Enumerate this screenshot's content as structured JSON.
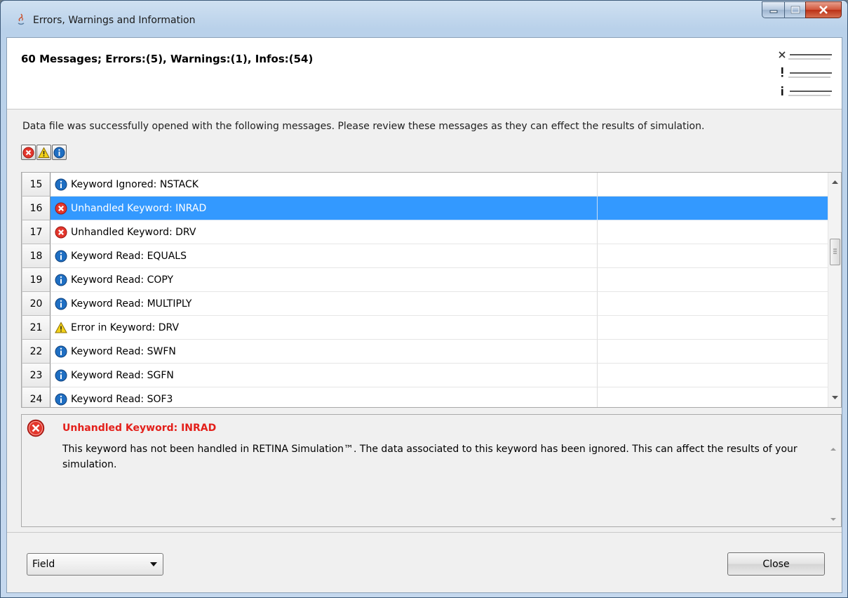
{
  "window": {
    "title": "Errors, Warnings and Information"
  },
  "header": {
    "summary": "60 Messages; Errors:(5), Warnings:(1), Infos:(54)"
  },
  "description": "Data file was successfully opened with the following messages. Please review these messages as they can effect the results of simulation.",
  "filters": [
    {
      "name": "error-filter",
      "icon": "error-icon"
    },
    {
      "name": "warning-filter",
      "icon": "warning-icon"
    },
    {
      "name": "info-filter",
      "icon": "info-icon"
    }
  ],
  "messages": [
    {
      "num": "15",
      "type": "info",
      "text": "Keyword Ignored: NSTACK"
    },
    {
      "num": "16",
      "type": "error",
      "text": "Unhandled Keyword: INRAD",
      "selected": true
    },
    {
      "num": "17",
      "type": "error",
      "text": "Unhandled Keyword: DRV"
    },
    {
      "num": "18",
      "type": "info",
      "text": "Keyword Read: EQUALS"
    },
    {
      "num": "19",
      "type": "info",
      "text": "Keyword Read: COPY"
    },
    {
      "num": "20",
      "type": "info",
      "text": "Keyword Read: MULTIPLY"
    },
    {
      "num": "21",
      "type": "warning",
      "text": "Error in Keyword: DRV"
    },
    {
      "num": "22",
      "type": "info",
      "text": "Keyword Read: SWFN"
    },
    {
      "num": "23",
      "type": "info",
      "text": "Keyword Read: SGFN"
    },
    {
      "num": "24",
      "type": "info",
      "text": "Keyword Read: SOF3"
    }
  ],
  "detail": {
    "title": "Unhandled Keyword: INRAD",
    "body": "This keyword has not been handled in RETINA Simulation™. The data associated to this keyword has been ignored. This can affect the results of your simulation."
  },
  "footer": {
    "select_value": "Field",
    "close_label": "Close"
  },
  "colors": {
    "selection": "#3399ff",
    "error": "#e3201b",
    "info": "#1a73c8",
    "warning": "#f3d21a"
  }
}
